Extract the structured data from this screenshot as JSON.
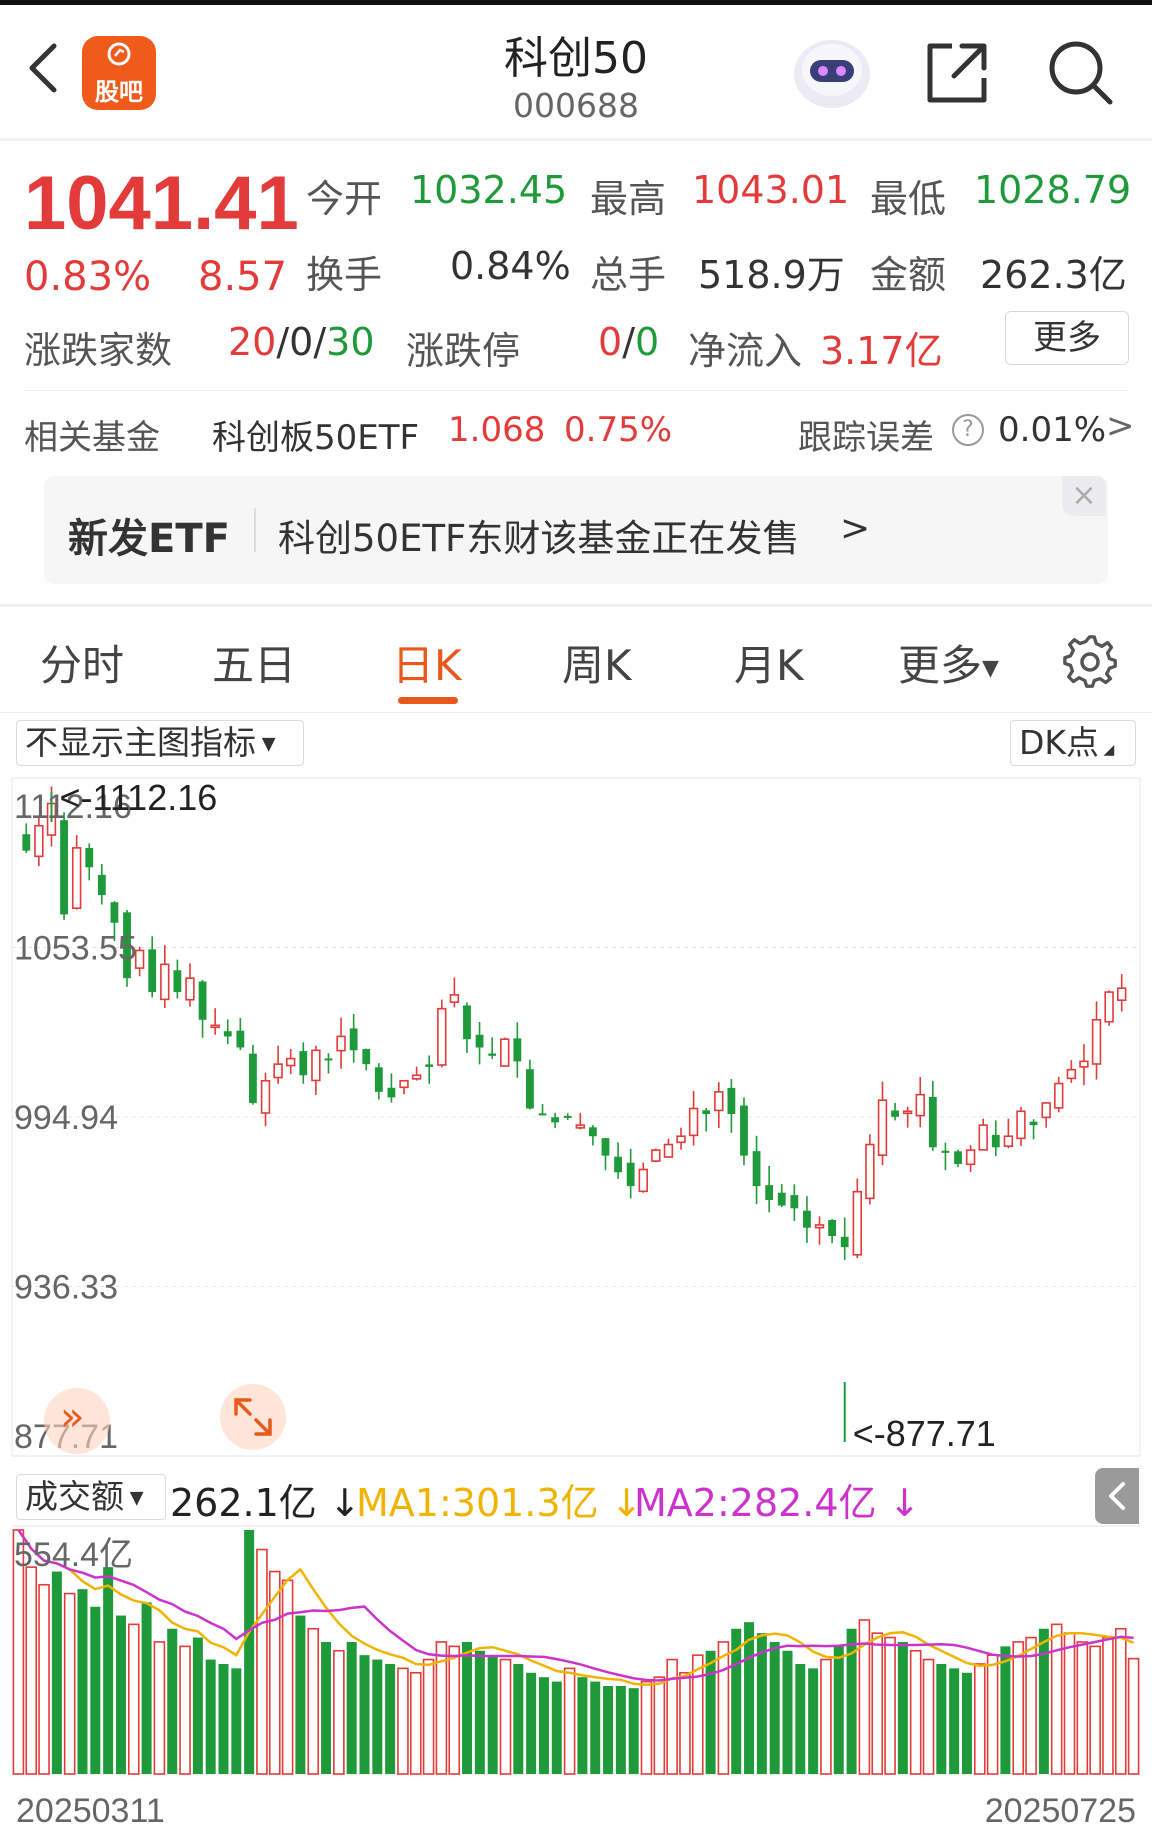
{
  "header": {
    "title": "科创50",
    "code": "000688",
    "logo_text": "股吧"
  },
  "quote": {
    "price": "1041.41",
    "change_pct": "0.83%",
    "change": "8.57",
    "open_label": "今开",
    "open": "1032.45",
    "high_label": "最高",
    "high": "1043.01",
    "low_label": "最低",
    "low": "1028.79",
    "turnover_label": "换手",
    "turnover": "0.84%",
    "volume_label": "总手",
    "volume": "518.9万",
    "amount_label": "金额",
    "amount": "262.3亿",
    "breadth_label": "涨跌家数",
    "breadth_up": "20",
    "breadth_sep1": "/",
    "breadth_flat": "0",
    "breadth_sep2": "/",
    "breadth_down": "30",
    "limit_label": "涨跌停",
    "limit_up": "0",
    "limit_sep": "/",
    "limit_down": "0",
    "inflow_label": "净流入",
    "inflow": "3.17亿",
    "more": "更多"
  },
  "fund": {
    "label": "相关基金",
    "name": "科创板50ETF",
    "price": "1.068",
    "pct": "0.75%",
    "track_label": "跟踪误差",
    "track_value": "0.01%"
  },
  "banner": {
    "tag": "新发ETF",
    "text": "科创50ETF东财该基金正在发售"
  },
  "tabs": [
    "分时",
    "五日",
    "日K",
    "周K",
    "月K",
    "更多"
  ],
  "chart_controls": {
    "indicator_select": "不显示主图指标",
    "dk_button": "DK点",
    "vol_select": "成交额",
    "vol_value": "262.1亿",
    "ma1": "MA1:301.3亿",
    "ma2": "MA2:282.4亿"
  },
  "colors": {
    "up": "#e33a3a",
    "down": "#1f9a3a",
    "accent": "#e8591c",
    "ma1": "#f0b400",
    "ma2": "#cc33cc"
  },
  "chart_data": {
    "type": "candlestick",
    "y_ticks": [
      "1112.16",
      "1053.55",
      "994.94",
      "936.33",
      "877.71"
    ],
    "ylim": [
      877.71,
      1112.16
    ],
    "max_marker": "<-1112.16",
    "min_marker": "<-877.71",
    "x_start": "20250311",
    "x_end": "20250725",
    "volume_max_label": "554.4亿",
    "volume_max": 554.4,
    "close": [
      1091,
      1100,
      1108,
      1068,
      1092,
      1085,
      1075,
      1065,
      1045,
      1055,
      1040,
      1050,
      1040,
      1045,
      1030,
      1028,
      1024,
      1020,
      1000,
      1008,
      1014,
      1016,
      1010,
      1019,
      1016,
      1024,
      1019,
      1014,
      1004,
      1002,
      1008,
      1010,
      1013,
      1034,
      1039,
      1023,
      1020,
      1017,
      1023,
      1015,
      998,
      996,
      993,
      995,
      992,
      988,
      981,
      975,
      970,
      976,
      983,
      985,
      988,
      998,
      996,
      1004,
      996,
      981,
      970,
      965,
      963,
      962,
      955,
      956,
      952,
      948,
      968,
      985,
      1001,
      995,
      997,
      1003,
      984,
      982,
      978,
      983,
      992,
      984,
      988,
      997,
      992,
      1000,
      1007,
      1012,
      1015,
      1030,
      1040,
      1041.41
    ],
    "volume_unit": "亿",
    "volume": [
      554.4,
      470,
      430,
      460,
      410,
      420,
      380,
      470,
      360,
      340,
      390,
      300,
      330,
      290,
      310,
      260,
      250,
      240,
      554.4,
      510,
      460,
      440,
      360,
      330,
      300,
      280,
      300,
      270,
      260,
      250,
      240,
      230,
      260,
      300,
      290,
      300,
      280,
      270,
      260,
      250,
      230,
      220,
      210,
      240,
      220,
      210,
      200,
      200,
      195,
      210,
      220,
      260,
      230,
      270,
      280,
      300,
      330,
      345,
      320,
      300,
      280,
      250,
      240,
      260,
      290,
      330,
      350,
      320,
      310,
      300,
      280,
      260,
      250,
      240,
      230,
      250,
      270,
      290,
      300,
      310,
      330,
      340,
      320,
      300,
      290,
      310,
      330,
      262.1
    ]
  }
}
